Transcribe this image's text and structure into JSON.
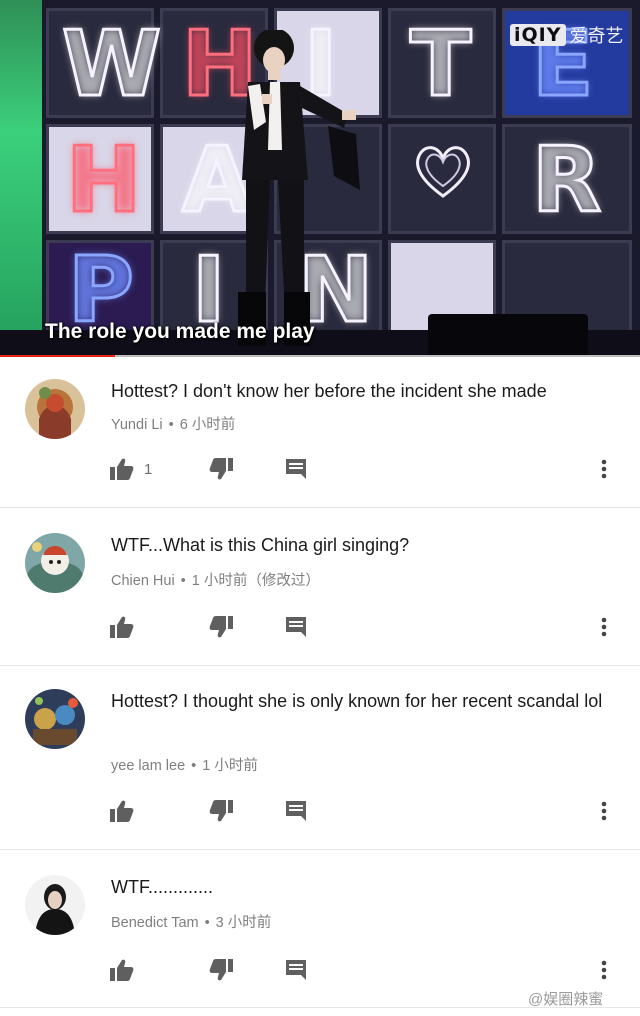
{
  "video": {
    "logo_mark": "iQIY",
    "logo_text": "爱奇艺",
    "subtitle": "The role you made me play",
    "wall_letters": [
      "W",
      "H",
      "I",
      "T",
      "E",
      "H",
      "A",
      "R",
      "P",
      "I",
      "N"
    ],
    "progress": 0.18
  },
  "comments": [
    {
      "text": "Hottest? I don't know her before the incident she made",
      "author": "Yundi Li",
      "time": "6 小时前",
      "like_count": "1"
    },
    {
      "text": "WTF...What is this China girl singing?",
      "author": "Chien Hui",
      "time": "1 小时前（修改过）",
      "like_count": ""
    },
    {
      "text": "Hottest? I thought she is only known for her recent scandal lol",
      "author": "yee lam lee",
      "time": "1 小时前",
      "like_count": ""
    },
    {
      "text": "WTF.............",
      "author": "Benedict Tam",
      "time": "3 小时前",
      "like_count": ""
    }
  ],
  "separator": "•",
  "watermark": "@娱圈辣蜜",
  "colors": {
    "progress_red": "#e62117",
    "meta_grey": "#7f7f7f",
    "icon_grey": "#5f5f5f"
  }
}
